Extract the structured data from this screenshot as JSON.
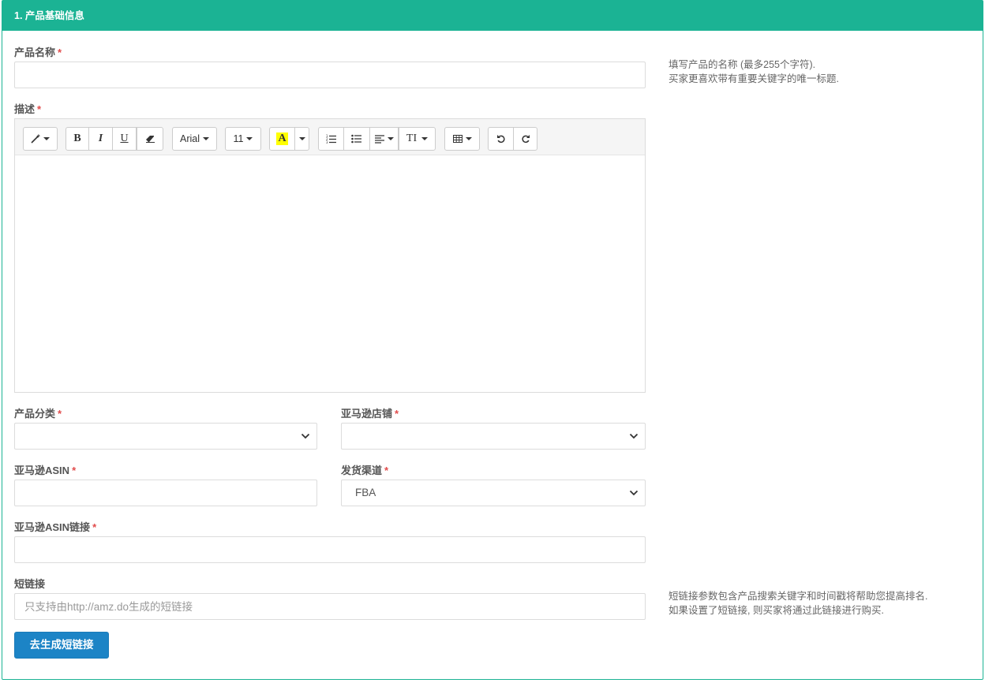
{
  "section": {
    "title": "1. 产品基础信息"
  },
  "fields": {
    "product_name": {
      "label": "产品名称",
      "required_mark": "*",
      "value": "",
      "placeholder": ""
    },
    "description": {
      "label": "描述",
      "required_mark": "*"
    },
    "category": {
      "label": "产品分类",
      "required_mark": "*",
      "value": ""
    },
    "store": {
      "label": "亚马逊店铺",
      "required_mark": "*",
      "value": ""
    },
    "asin": {
      "label": "亚马逊ASIN",
      "required_mark": "*",
      "value": ""
    },
    "channel": {
      "label": "发货渠道",
      "required_mark": "*",
      "value": "FBA"
    },
    "asin_link": {
      "label": "亚马逊ASIN链接",
      "required_mark": "*",
      "value": ""
    },
    "short_link": {
      "label": "短链接",
      "value": "",
      "placeholder": "只支持由http://amz.do生成的短链接"
    }
  },
  "help": {
    "product_name_line1": "填写产品的名称 (最多255个字符).",
    "product_name_line2": "买家更喜欢带有重要关键字的唯一标题.",
    "short_link_line1": "短链接参数包含产品搜索关键字和时间戳将帮助您提高排名.",
    "short_link_line2": "如果设置了短链接, 则买家将通过此链接进行购买."
  },
  "editor": {
    "toolbar": {
      "style_icon": "magic-pen-icon",
      "bold": "B",
      "italic": "I",
      "underline": "U",
      "eraser_icon": "eraser-icon",
      "font_name": "Arial",
      "font_size": "11",
      "color_letter": "A",
      "ol_icon": "ordered-list-icon",
      "ul_icon": "unordered-list-icon",
      "align_icon": "align-left-icon",
      "line_height": "TI",
      "table_icon": "table-icon",
      "undo_icon": "undo-icon",
      "redo_icon": "redo-icon"
    },
    "content": ""
  },
  "actions": {
    "generate_short_link": "去生成短链接"
  },
  "colors": {
    "header": "#1bb394",
    "primary_button": "#1c84c6",
    "required": "#e14b4b",
    "highlight": "#ffff00"
  }
}
